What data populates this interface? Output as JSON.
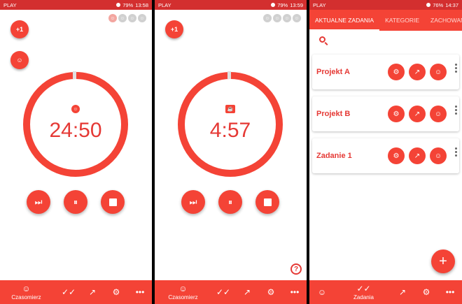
{
  "status_bars": [
    {
      "carrier": "PLAY",
      "battery": "79%",
      "time": "13:58"
    },
    {
      "carrier": "PLAY",
      "battery": "79%",
      "time": "13:59"
    },
    {
      "carrier": "PLAY",
      "battery": "76%",
      "time": "14:37"
    }
  ],
  "timer1": {
    "plus_label": "+1",
    "time": "24:50",
    "progress_fraction": 0.98
  },
  "timer2": {
    "plus_label": "+1",
    "time": "4:57",
    "progress_fraction": 0.98
  },
  "controls": {
    "skip": "⏭",
    "pause": "⏸"
  },
  "nav": {
    "timer_label": "Czasomierz",
    "tasks_label": "Zadania",
    "icons": [
      "head-icon",
      "checks-icon",
      "trend-icon",
      "gear-icon",
      "more-icon"
    ]
  },
  "help": {
    "label": "?"
  },
  "tabs": [
    {
      "label": "AKTUALNE ZADANIA"
    },
    {
      "label": "KATEGORIE"
    },
    {
      "label": "ZACHOWANE Z"
    }
  ],
  "tasks": [
    {
      "title": "Projekt A"
    },
    {
      "title": "Projekt B"
    },
    {
      "title": "Zadanie 1"
    }
  ],
  "fab": {
    "label": "+"
  },
  "colors": {
    "accent": "#f44336",
    "statusbar": "#d32f2f",
    "text_red": "#e53935"
  }
}
